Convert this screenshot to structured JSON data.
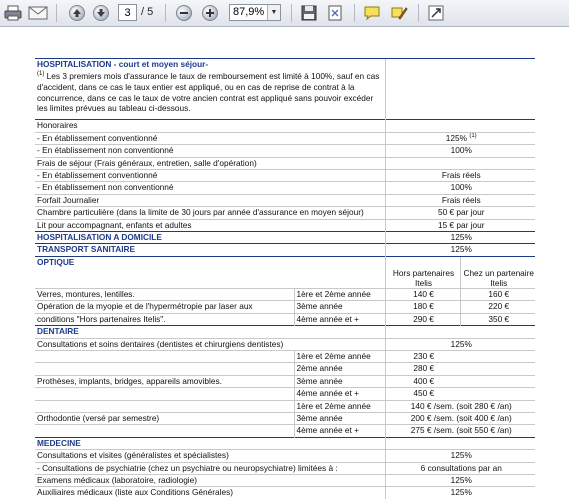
{
  "toolbar": {
    "page_current": "3",
    "page_total": "/ 5",
    "zoom": "87,9%"
  },
  "doc": {
    "hosp_header": "HOSPITALISATION - court et moyen séjour-",
    "hosp_note_mark": "(1)",
    "hosp_note": "Les 3 premiers mois d'assurance le taux de remboursement est limité à 100%, sauf en cas d'accident, dans ce cas le taux entier est appliqué, ou en cas de reprise de contrat à la concurrence, dans ce cas le taux de votre ancien contrat est appliqué sans pouvoir excéder les limites prévues au tableau ci-dessous.",
    "honoraires": "Honoraires",
    "conv": " - En établissement conventionné",
    "conv_val": "125%",
    "conv_val_note": "(1)",
    "nonconv": " - En établissement non conventionné",
    "nonconv_val": "100%",
    "frais_sejour": "Frais de séjour (Frais généraux, entretien, salle d'opération)",
    "frais_reels": "Frais réels",
    "forfait": "Forfait Journalier",
    "chambre": "Chambre particulière (dans la limite de 30 jours par année d'assurance en moyen séjour)",
    "chambre_val": "50 € par jour",
    "lit": "Lit pour accompagnant, enfants et adultes",
    "lit_val": "15 € par jour",
    "hosp_dom": "HOSPITALISATION A DOMICILE",
    "hosp_dom_val": "125%",
    "transport": "TRANSPORT SANITAIRE",
    "transport_val": "125%",
    "optique": "OPTIQUE",
    "col_hors": "Hors partenaires Itelis",
    "col_chez": "Chez un partenaire Itelis",
    "verres": "Verres, montures, lentilles.",
    "operation_1": "Opération de la myopie et de l'hypermétropie par laser aux",
    "operation_2": "conditions \"Hors partenaires Itelis\".",
    "annee_12": "1ère et 2ème année",
    "annee_3": "3ème année",
    "annee_4": "4ème année et +",
    "opt_hors": [
      "140 €",
      "180 €",
      "290 €"
    ],
    "opt_chez": [
      "160 €",
      "220 €",
      "350 €"
    ],
    "dentaire": "DENTAIRE",
    "consult_dent": "Consultations et soins dentaires (dentistes et chirurgiens dentistes)",
    "consult_dent_val": "125%",
    "annee_2": "2ème année",
    "protheses": "Prothèses, implants, bridges, appareils amovibles.",
    "proth_vals": [
      "230 €",
      "280 €",
      "400 €",
      "450 €"
    ],
    "ortho": "Orthodontie (versé par semestre)",
    "ortho_vals": [
      "140 € /sem. (soit 280 € /an)",
      "200 € /sem. (soit 400 € /an)",
      "275 € /sem. (soit 550 € /an)"
    ],
    "medecine": "MEDECINE",
    "consult_gen": "Consultations et visites (généralistes et spécialistes)",
    "consult_gen_val": "125%",
    "psy": "  - Consultations de psychiatrie (chez un psychiatre ou neuropsychiatre) limitées à :",
    "psy_val": "6 consultations par an",
    "examens": "Examens médicaux (laboratoire, radiologie)",
    "examens_val": "125%",
    "auxiliaires": "Auxiliaires médicaux (liste aux Conditions Générales)",
    "auxiliaires_val": "125%"
  }
}
